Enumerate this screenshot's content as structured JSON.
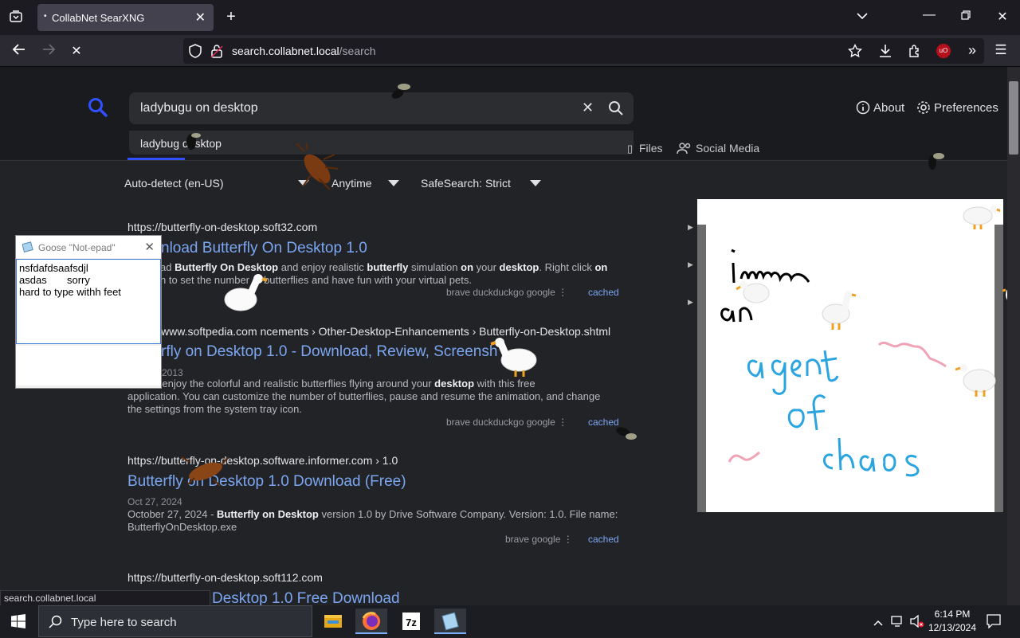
{
  "browser": {
    "tab_title": "CollabNet SearXNG",
    "url_host": "search.collabnet.local",
    "url_path": "/search"
  },
  "search": {
    "query": "ladybugu on desktop",
    "suggestion": "ladybug desktop"
  },
  "header_links": {
    "about": "About",
    "preferences": "Preferences"
  },
  "categories": [
    {
      "label": "Files"
    },
    {
      "label": "Social Media"
    }
  ],
  "filters": {
    "language": "Auto-detect (en-US)",
    "time": "Anytime",
    "safesearch": "SafeSearch: Strict"
  },
  "results": [
    {
      "url": "https://butterfly-on-desktop.soft32.com",
      "title": "nload Butterfly On Desktop 1.0",
      "snippet_html": "ad <b>Butterfly On Desktop</b> and enjoy realistic <b>butterfly</b> simulation <b>on</b> your <b>desktop</b>. Right click <b>on</b><br>n to set the number of butterflies and have fun with your virtual pets.",
      "engines": "brave   duckduckgo   google   ⋮",
      "cached": "cached"
    },
    {
      "url": "www.softpedia.com  ncements › Other-Desktop-Enhancements › Butterfly-on-Desktop.shtml",
      "title": "rfly on Desktop 1.0 - Download, Review, Screensh",
      "date": "2013",
      "snippet_html": "ad and enjoy the colorful and realistic butterflies flying around your <b>desktop</b> with this free<br>application. You can customize the number of butterflies, pause and resume the animation, and change<br>the settings from the system tray icon.",
      "engines": "brave   duckduckgo   google   ⋮",
      "cached": "cached"
    },
    {
      "url": "https://butterfly-on-desktop.software.informer.com  › 1.0",
      "title": "Butterfly on Desktop 1.0 Download (Free)",
      "date": "Oct 27, 2024",
      "snippet_html": "October 27, 2024 - <b>Butterfly on Desktop</b> version 1.0 by Drive Software Company. Version: 1.0. File name:<br>ButterflyOnDesktop.exe",
      "engines": "brave   google   ⋮",
      "cached": "cached"
    },
    {
      "url": "https://butterfly-on-desktop.soft112.com",
      "title": "Desktop 1.0 Free Download"
    }
  ],
  "notepad": {
    "title": "Goose \"Not-epad\"",
    "content": "nsfdafdsaafsdjl\nasdas       sorry\nhard to type withh feet"
  },
  "drawing_panel": {
    "text": "i'm an agent of chaos"
  },
  "status_bar": "search.collabnet.local",
  "taskbar": {
    "search_placeholder": "Type here to search",
    "time": "6:14 PM",
    "date": "12/13/2024"
  }
}
